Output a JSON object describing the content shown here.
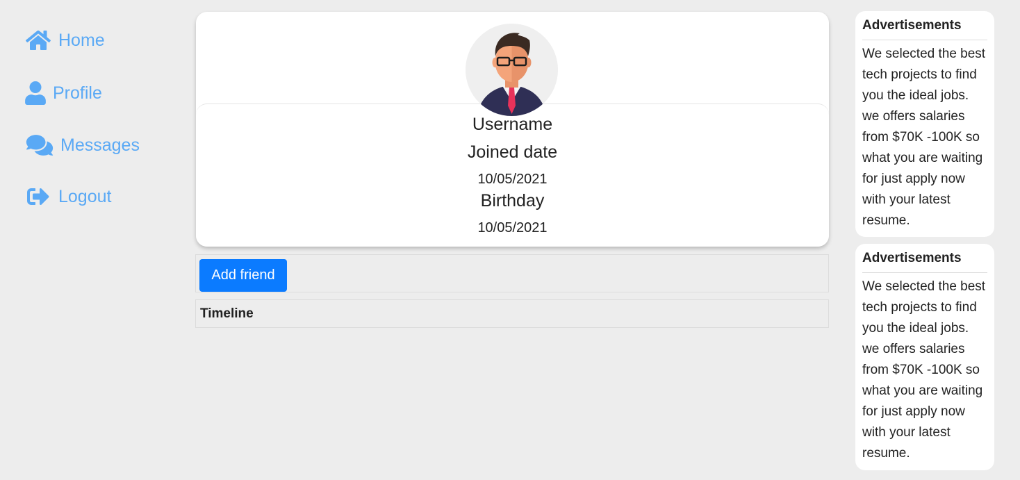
{
  "sidebar": {
    "items": [
      {
        "label": "Home",
        "icon": "home-icon"
      },
      {
        "label": "Profile",
        "icon": "user-icon"
      },
      {
        "label": "Messages",
        "icon": "comments-icon"
      },
      {
        "label": "Logout",
        "icon": "sign-out-icon"
      }
    ]
  },
  "profile": {
    "avatar_icon": "user-avatar",
    "username": "Username",
    "joined_label": "Joined date",
    "joined_value": "10/05/2021",
    "birthday_label": "Birthday",
    "birthday_value": "10/05/2021"
  },
  "actions": {
    "add_friend_label": "Add friend"
  },
  "timeline": {
    "title": "Timeline"
  },
  "ads": [
    {
      "title": "Advertisements",
      "body": "We selected the best tech projects to find you the ideal jobs. we offers salaries from $70K -100K so what you are waiting for just apply now with your latest resume."
    },
    {
      "title": "Advertisements",
      "body": "We selected the best tech projects to find you the ideal jobs. we offers salaries from $70K -100K so what you are waiting for just apply now with your latest resume."
    }
  ],
  "colors": {
    "accent": "#5aa9f5",
    "button": "#0b7bff",
    "background": "#ededed"
  }
}
